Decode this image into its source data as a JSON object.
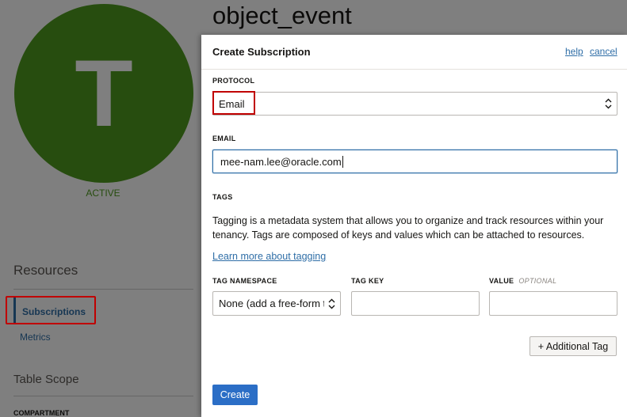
{
  "background": {
    "avatar_letter": "T",
    "status": "ACTIVE",
    "page_title": "object_event",
    "resources_heading": "Resources",
    "nav": {
      "subscriptions": "Subscriptions",
      "metrics": "Metrics"
    },
    "table_scope_heading": "Table Scope",
    "compartment_label": "COMPARTMENT"
  },
  "dialog": {
    "title": "Create Subscription",
    "help_link": "help",
    "cancel_link": "cancel",
    "protocol": {
      "label": "PROTOCOL",
      "value": "Email"
    },
    "email": {
      "label": "EMAIL",
      "value": "mee-nam.lee@oracle.com"
    },
    "tags": {
      "label": "TAGS",
      "description": "Tagging is a metadata system that allows you to organize and track resources within your tenancy. Tags are composed of keys and values which can be attached to resources.",
      "learn_more": "Learn more about tagging",
      "namespace_label": "TAG NAMESPACE",
      "namespace_value": "None (add a free-form tag)",
      "key_label": "TAG KEY",
      "key_value": "",
      "value_label": "VALUE",
      "value_optional": "OPTIONAL",
      "value_value": "",
      "add_button": "+ Additional Tag"
    },
    "create_button": "Create"
  },
  "colors": {
    "avatar": "#4f9b1f",
    "link": "#2f6ea7",
    "primary_button": "#2b6ec6",
    "highlight": "#c00000"
  }
}
